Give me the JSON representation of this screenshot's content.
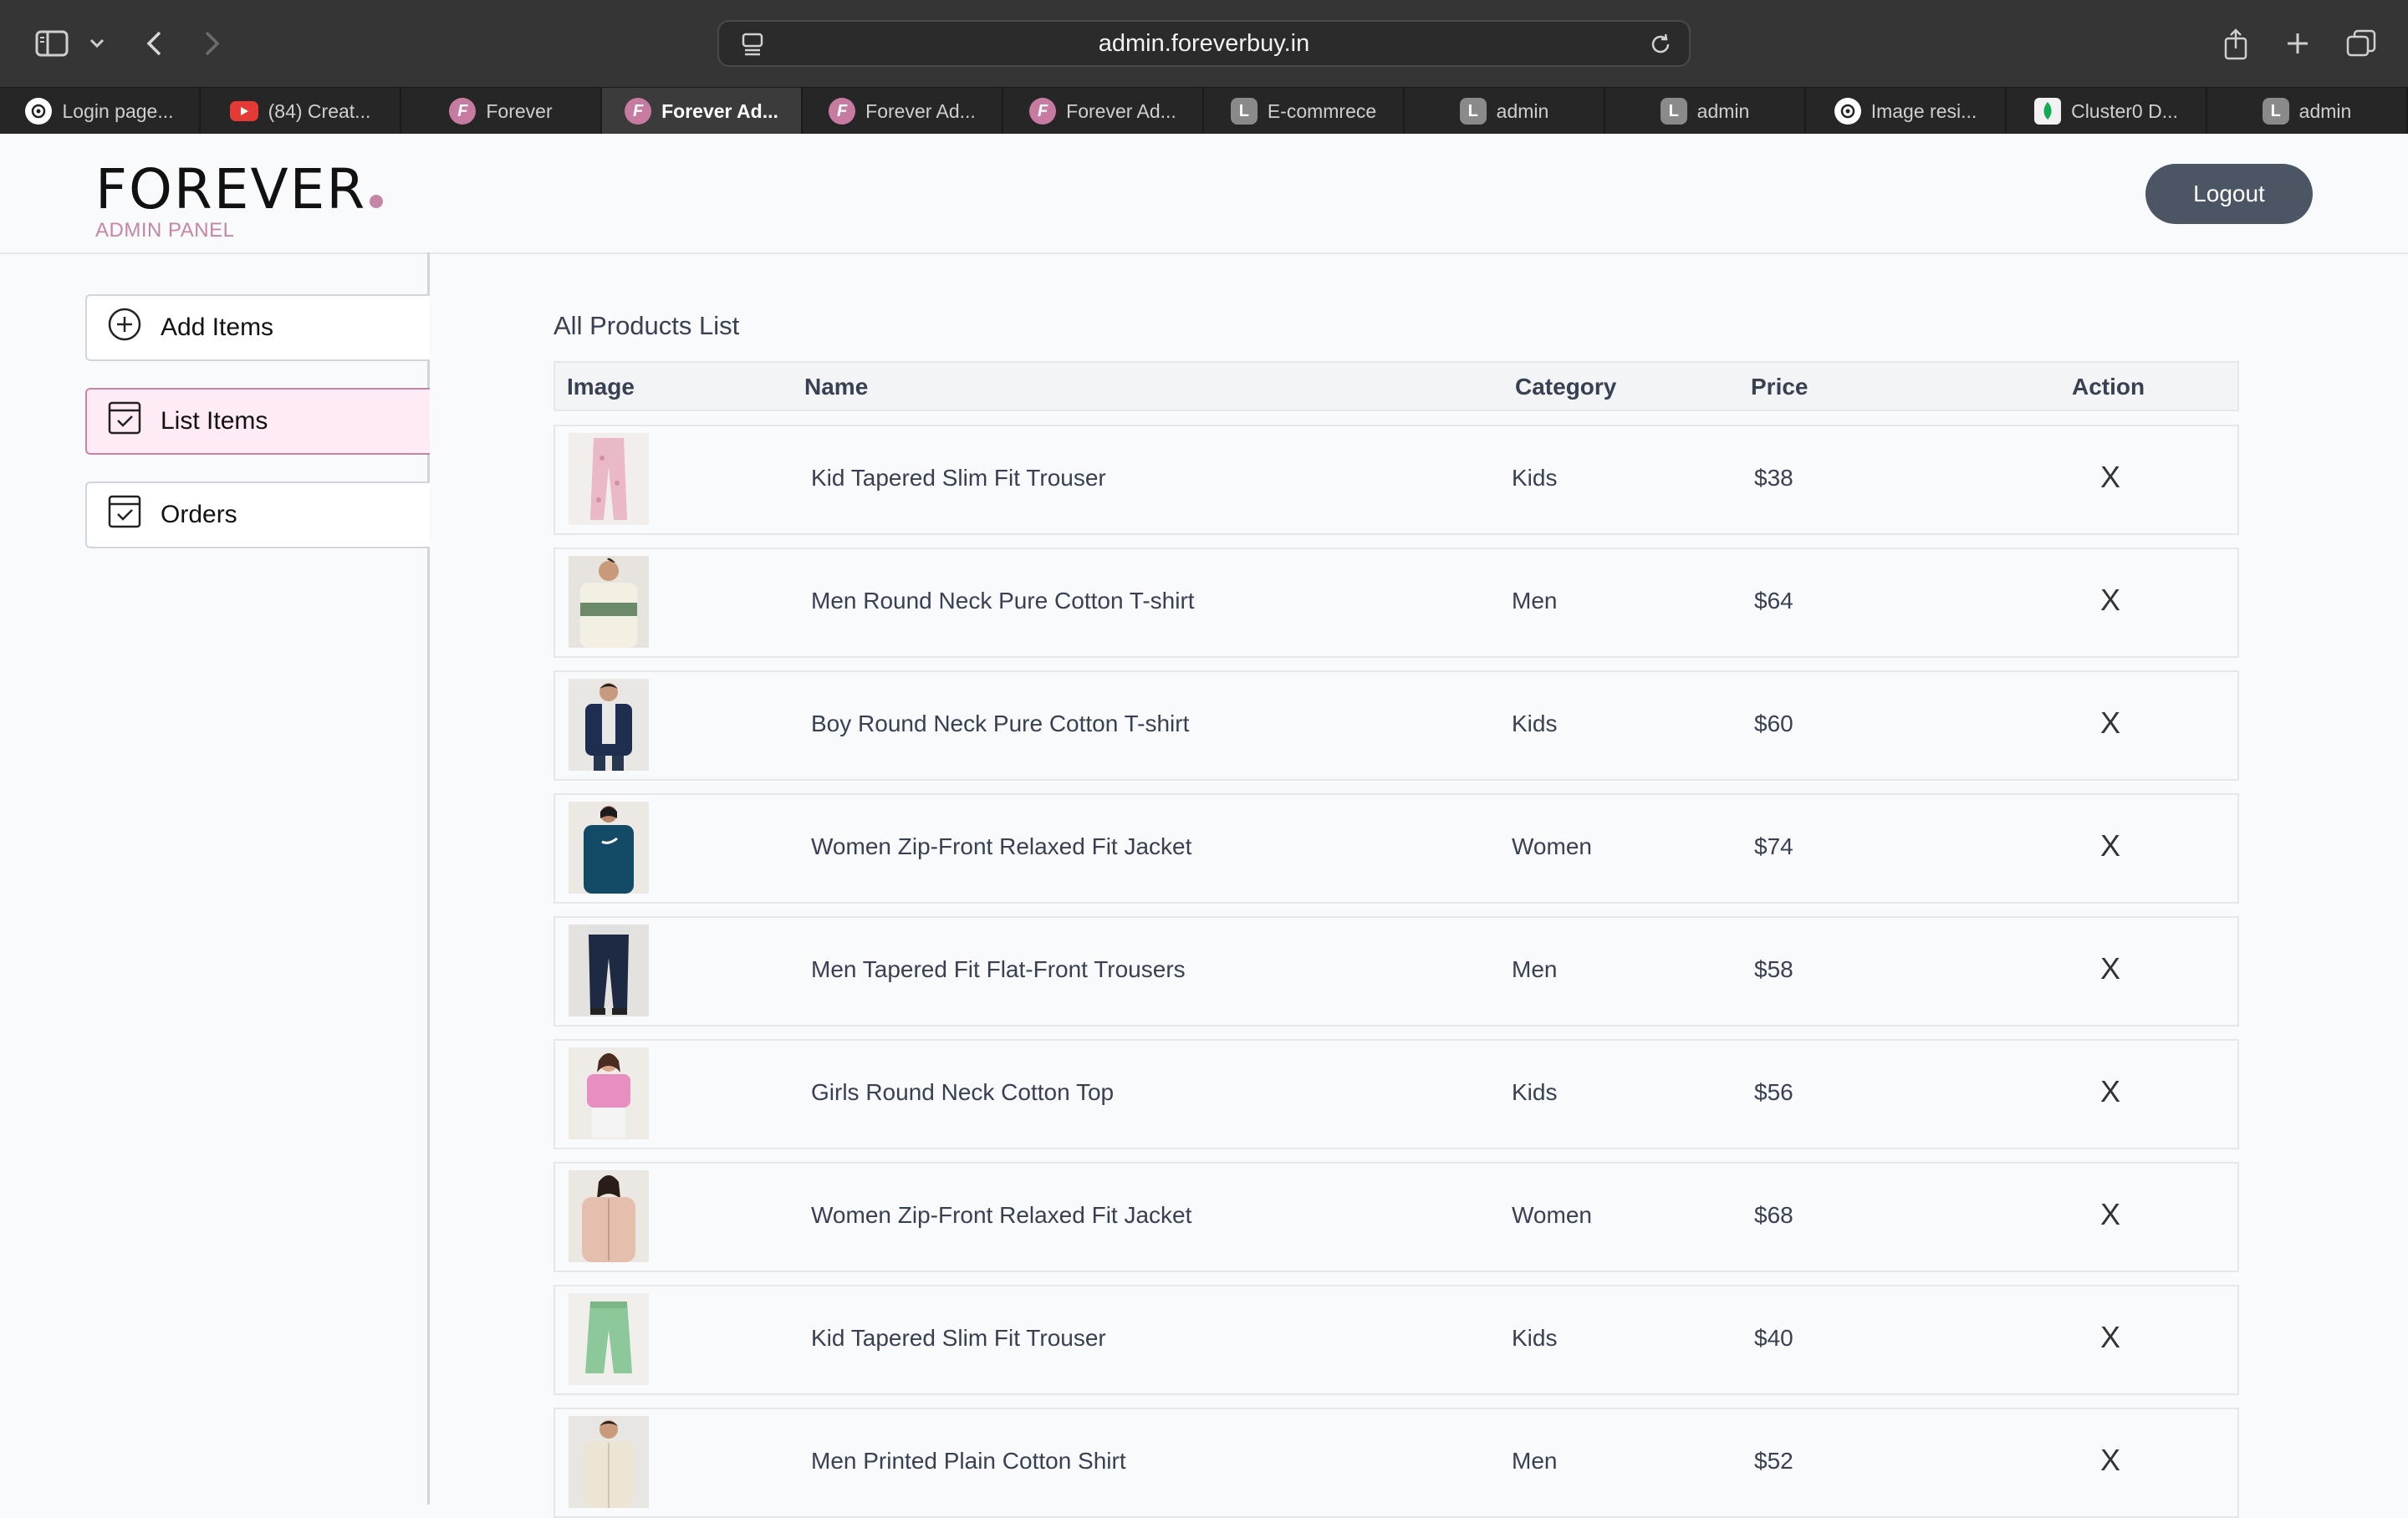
{
  "browser": {
    "url": "admin.foreverbuy.in",
    "tabs": [
      {
        "label": "Login page...",
        "icon": "chatgpt-icon"
      },
      {
        "label": "(84) Creat...",
        "icon": "youtube-icon"
      },
      {
        "label": "Forever",
        "icon": "forever-icon"
      },
      {
        "label": "Forever Ad...",
        "icon": "forever-icon",
        "active": true
      },
      {
        "label": "Forever Ad...",
        "icon": "forever-icon"
      },
      {
        "label": "Forever Ad...",
        "icon": "forever-icon"
      },
      {
        "label": "E-commrece",
        "icon": "l-icon"
      },
      {
        "label": "admin",
        "icon": "l-icon"
      },
      {
        "label": "admin",
        "icon": "l-icon"
      },
      {
        "label": "Image resi...",
        "icon": "chatgpt-icon"
      },
      {
        "label": "Cluster0 D...",
        "icon": "mongodb-icon"
      },
      {
        "label": "admin",
        "icon": "l-icon"
      }
    ]
  },
  "header": {
    "logo": "FOREVER",
    "subtitle": "ADMIN PANEL",
    "logout_label": "Logout",
    "accent": "#c586a5"
  },
  "sidebar": {
    "items": [
      {
        "label": "Add Items",
        "icon": "plus-circle-icon"
      },
      {
        "label": "List Items",
        "icon": "checkbox-icon",
        "active": true
      },
      {
        "label": "Orders",
        "icon": "checkbox-icon"
      }
    ]
  },
  "main": {
    "title": "All Products List",
    "columns": [
      "Image",
      "Name",
      "Category",
      "Price",
      "Action"
    ],
    "rows": [
      {
        "name": "Kid Tapered Slim Fit Trouser",
        "category": "Kids",
        "price": "$38",
        "action": "X"
      },
      {
        "name": "Men Round Neck Pure Cotton T-shirt",
        "category": "Men",
        "price": "$64",
        "action": "X"
      },
      {
        "name": "Boy Round Neck Pure Cotton T-shirt",
        "category": "Kids",
        "price": "$60",
        "action": "X"
      },
      {
        "name": "Women Zip-Front Relaxed Fit Jacket",
        "category": "Women",
        "price": "$74",
        "action": "X"
      },
      {
        "name": "Men Tapered Fit Flat-Front Trousers",
        "category": "Men",
        "price": "$58",
        "action": "X"
      },
      {
        "name": "Girls Round Neck Cotton Top",
        "category": "Kids",
        "price": "$56",
        "action": "X"
      },
      {
        "name": "Women Zip-Front Relaxed Fit Jacket",
        "category": "Women",
        "price": "$68",
        "action": "X"
      },
      {
        "name": "Kid Tapered Slim Fit Trouser",
        "category": "Kids",
        "price": "$40",
        "action": "X"
      },
      {
        "name": "Men Printed Plain Cotton Shirt",
        "category": "Men",
        "price": "$52",
        "action": "X"
      }
    ]
  }
}
